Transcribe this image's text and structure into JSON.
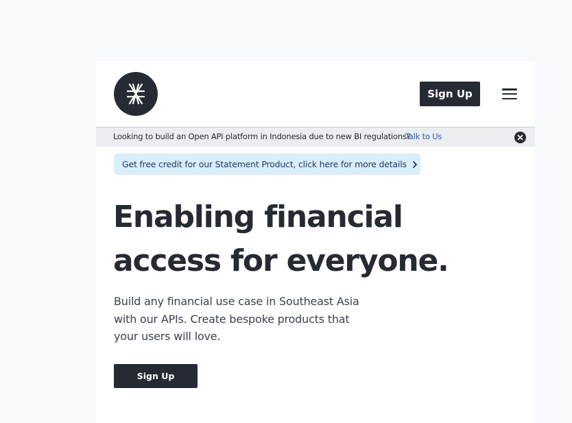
{
  "header": {
    "logo_icon": "asterisk-x-logo",
    "signup_label": "Sign Up",
    "menu_icon": "hamburger-menu-icon"
  },
  "banner": {
    "text": "Looking to build an Open API platform in Indonesia due to new BI regulations?",
    "link_label": "Talk to Us",
    "close_icon": "close-circle-icon"
  },
  "promo": {
    "text": "Get free credit for our Statement Product, click here for more details",
    "chevron_icon": "chevron-right-icon"
  },
  "hero": {
    "headline_line1": "Enabling financial",
    "headline_line2": "access for everyone.",
    "subtext": "Build any financial use case in Southeast Asia with our APIs. Create bespoke products that your users will love.",
    "signup_label": "Sign Up"
  },
  "colors": {
    "page_bg": "#f8f9fc",
    "dark": "#262a33",
    "banner_bg": "#ebedf1",
    "link_blue": "#2a5bb8",
    "promo_bg": "#d9eefb"
  }
}
